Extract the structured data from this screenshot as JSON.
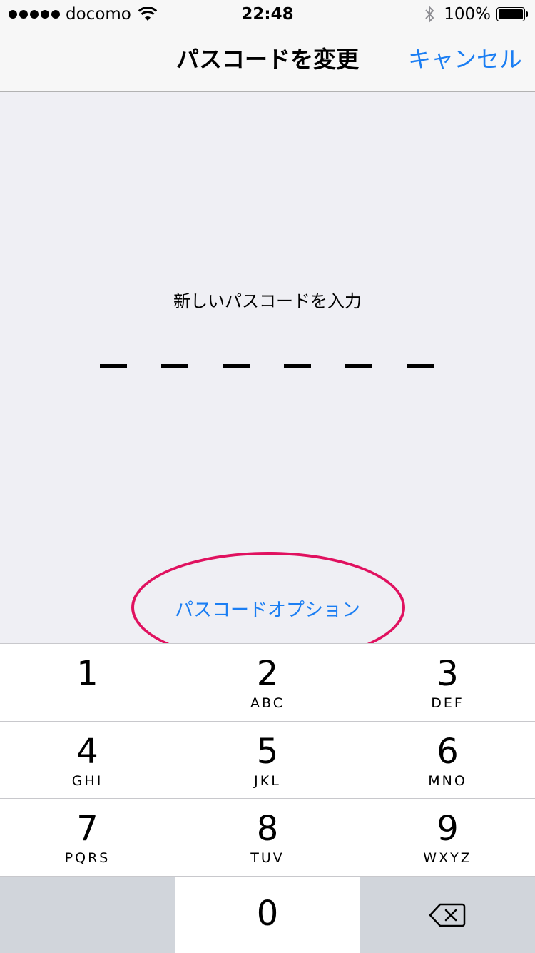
{
  "status_bar": {
    "carrier": "docomo",
    "time": "22:48",
    "battery_percent": "100%",
    "battery_level": 1.0,
    "signal_bars": 5,
    "icons": [
      "signal-dots",
      "wifi-icon",
      "bluetooth-icon",
      "battery-icon"
    ]
  },
  "nav": {
    "title": "パスコードを変更",
    "cancel_label": "キャンセル"
  },
  "passcode": {
    "prompt": "新しいパスコードを入力",
    "digit_slots": 6,
    "entered_digits": 0,
    "options_label": "パスコードオプション"
  },
  "keypad": {
    "keys": [
      {
        "number": "1",
        "letters": ""
      },
      {
        "number": "2",
        "letters": "ABC"
      },
      {
        "number": "3",
        "letters": "DEF"
      },
      {
        "number": "4",
        "letters": "GHI"
      },
      {
        "number": "5",
        "letters": "JKL"
      },
      {
        "number": "6",
        "letters": "MNO"
      },
      {
        "number": "7",
        "letters": "PQRS"
      },
      {
        "number": "8",
        "letters": "TUV"
      },
      {
        "number": "9",
        "letters": "WXYZ"
      },
      {
        "number": "0",
        "letters": ""
      }
    ],
    "delete_icon": "delete-backspace-icon"
  },
  "colors": {
    "accent": "#1b7ef3",
    "highlight_ellipse": "#e0115f",
    "background": "#efeff4",
    "keypad_grey": "#d1d5db"
  }
}
